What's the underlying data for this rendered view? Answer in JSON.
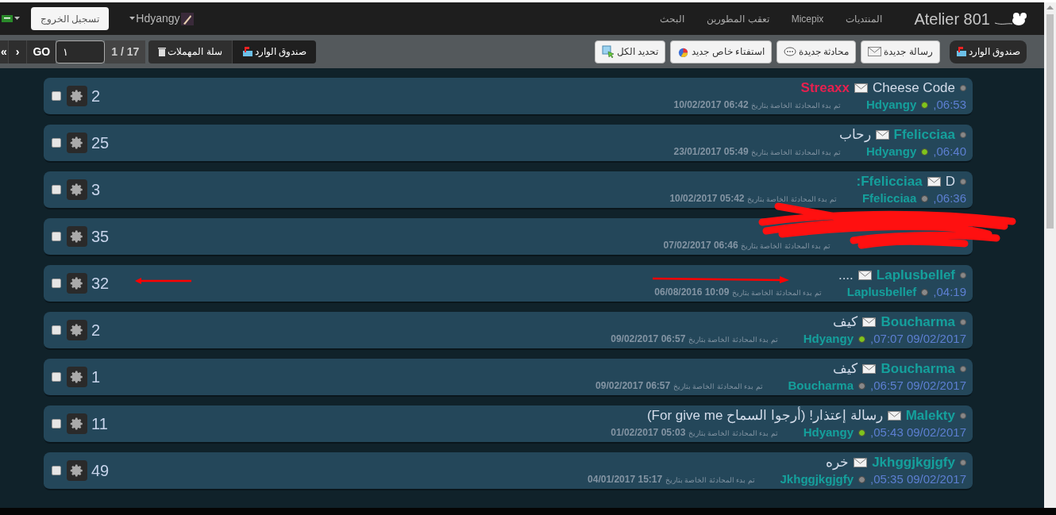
{
  "top_bar": {
    "site_title": "Atelier 801",
    "nav": [
      "المنتديات",
      "Micepix",
      "تعقب المطورين",
      "البحث"
    ],
    "user": "Hdyangy",
    "logout": "تسجيل الخروج"
  },
  "toolbar": {
    "inbox_button": "صندوق الوارد",
    "actions": [
      "رسالة جديدة",
      "محادثة جديدة",
      "استفتاء خاص جديد",
      "تحديد الكل"
    ],
    "folders": [
      {
        "label": "صندوق الوارد",
        "selected": true
      },
      {
        "label": "سلة المهملات",
        "selected": false
      }
    ],
    "page_info": "1 / 17",
    "page_input": "١",
    "go": "GO",
    "next": "›",
    "last": "«"
  },
  "conversations": [
    {
      "title": {
        "text": "Cheese Code",
        "kind": "subject"
      },
      "other": {
        "text": "Streaxx",
        "kind": "staff"
      },
      "time": ",06:53",
      "last_user": "Hdyangy",
      "online": true,
      "started_label": "تم بدء المحادثة الخاصة بتاريخ",
      "started": "06:42 10/02/2017",
      "count": "2",
      "checked": false,
      "redacted": false
    },
    {
      "title": {
        "text": "Ffelicciaa",
        "kind": "user"
      },
      "other": {
        "text": "رحاب",
        "kind": "subject"
      },
      "time": ",06:40",
      "last_user": "Hdyangy",
      "online": true,
      "started_label": "تم بدء المحادثة الخاصة بتاريخ",
      "started": "05:49 23/01/2017",
      "count": "25",
      "checked": false,
      "redacted": false
    },
    {
      "title": {
        "text": "D",
        "kind": "subject"
      },
      "other": {
        "text": ":Ffelicciaa",
        "kind": "user"
      },
      "time": ",06:36",
      "last_user": "Ffelicciaa",
      "online": false,
      "started_label": "تم بدء المحادثة الخاصة بتاريخ",
      "started": "05:42 10/02/2017",
      "count": "3",
      "checked": false,
      "redacted": false
    },
    {
      "started_label": "تم بدء المحادثة الخاصة بتاريخ",
      "started": "06:46 07/02/2017",
      "count": "35",
      "checked": false,
      "redacted": true
    },
    {
      "title": {
        "text": "Laplusbellef",
        "kind": "user"
      },
      "other": {
        "text": "....",
        "kind": "subject"
      },
      "time": ",04:19",
      "last_user": "Laplusbellef",
      "online": false,
      "started_label": "تم بدء المحادثة الخاصة بتاريخ",
      "started": "10:09 06/08/2016",
      "count": "32",
      "checked": false,
      "redacted": false
    },
    {
      "title": {
        "text": "Boucharma",
        "kind": "user"
      },
      "other": {
        "text": "كيف",
        "kind": "subject"
      },
      "time": ",07:07 09/02/2017",
      "last_user": "Hdyangy",
      "online": true,
      "started_label": "تم بدء المحادثة الخاصة بتاريخ",
      "started": "06:57 09/02/2017",
      "count": "2",
      "checked": false,
      "redacted": false
    },
    {
      "title": {
        "text": "Boucharma",
        "kind": "user"
      },
      "other": {
        "text": "كيف",
        "kind": "subject"
      },
      "time": ",06:57 09/02/2017",
      "last_user": "Boucharma",
      "online": false,
      "started_label": "تم بدء المحادثة الخاصة بتاريخ",
      "started": "06:57 09/02/2017",
      "count": "1",
      "checked": false,
      "redacted": false
    },
    {
      "title": {
        "text": "Malekty",
        "kind": "user"
      },
      "other": {
        "text": "رسالة إعتذار! (أرجوا السماح For give me)",
        "kind": "subject"
      },
      "time": ",05:43 09/02/2017",
      "last_user": "Hdyangy",
      "online": true,
      "started_label": "تم بدء المحادثة الخاصة بتاريخ",
      "started": "05:03 01/02/2017",
      "count": "11",
      "checked": false,
      "redacted": false
    },
    {
      "title": {
        "text": "Jkhggjkgjgfy",
        "kind": "user"
      },
      "other": {
        "text": "خره",
        "kind": "subject"
      },
      "time": ",05:35 09/02/2017",
      "last_user": "Jkhggjkgjgfy",
      "online": false,
      "started_label": "تم بدء المحادثة الخاصة بتاريخ",
      "started": "15:17 04/01/2017",
      "count": "49",
      "checked": false,
      "redacted": false
    }
  ]
}
